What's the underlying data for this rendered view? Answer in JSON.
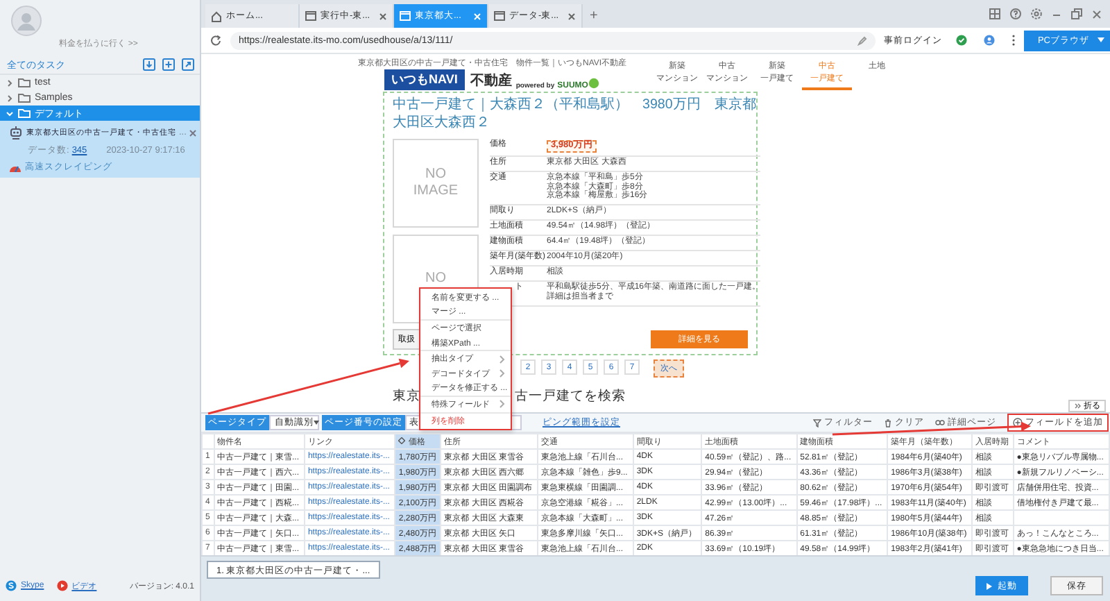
{
  "account": {
    "billing_link": "料金を払うに行く >>"
  },
  "sidebar": {
    "header": "全てのタスク",
    "folders": [
      {
        "label": "test",
        "expanded": false,
        "selected": false
      },
      {
        "label": "Samples",
        "expanded": false,
        "selected": false
      },
      {
        "label": "デフォルト",
        "expanded": true,
        "selected": true,
        "tasks": [
          {
            "title": "東京都大田区の中古一戸建て・中古住宅",
            "more": "...",
            "count_label": "データ数:",
            "count": "345",
            "timestamp": "2023-10-27 9:17:16",
            "mode": "高速スクレイピング"
          }
        ]
      }
    ],
    "help_links": [
      {
        "label": "Skype",
        "kind": "skype"
      },
      {
        "label": "ビデオ",
        "kind": "video"
      }
    ],
    "version": "バージョン: 4.0.1"
  },
  "browser": {
    "tabs": [
      {
        "label": "ホーム...",
        "kind": "home",
        "selected": false,
        "closable": false
      },
      {
        "label": "実行中-東...",
        "kind": "page",
        "selected": false,
        "closable": true
      },
      {
        "label": "東京都大...",
        "kind": "page",
        "selected": true,
        "closable": true
      },
      {
        "label": "データ-東...",
        "kind": "page",
        "selected": false,
        "closable": true
      }
    ],
    "new_tab": "+",
    "url": "https://realestate.its-mo.com/usedhouse/a/13/111/",
    "pre_login": "事前ログイン",
    "browser_mode": "PCブラウザ"
  },
  "page": {
    "breadcrumb": "東京都大田区の中古一戸建て・中古住宅　物件一覧｜いつもNAVI不動産",
    "logo": {
      "brand": "いつもNAVI",
      "category": "不動産",
      "powered_by": "powered by",
      "partner": "SUUMO"
    },
    "nav": [
      {
        "lines": [
          "新築",
          "マンション"
        ],
        "selected": false
      },
      {
        "lines": [
          "中古",
          "マンション"
        ],
        "selected": false
      },
      {
        "lines": [
          "新築",
          "一戸建て"
        ],
        "selected": false
      },
      {
        "lines": [
          "中古",
          "一戸建て"
        ],
        "selected": true
      },
      {
        "lines": [
          "土地"
        ],
        "selected": false
      }
    ],
    "listing": {
      "title_lines": [
        "中古一戸建て｜大森西２（平和島駅）　3980万円　東京都",
        "大田区大森西２"
      ],
      "images": [
        {
          "lines": [
            "NO",
            "IMAGE"
          ]
        },
        {
          "lines": [
            "NO"
          ]
        }
      ],
      "details": [
        {
          "label": "価格",
          "kind": "price",
          "lines": [
            "3,980万円"
          ]
        },
        {
          "label": "住所",
          "kind": "text",
          "lines": [
            "東京都 大田区 大森西"
          ]
        },
        {
          "label": "交通",
          "kind": "text",
          "lines": [
            "京急本線「平和島」歩5分",
            "京急本線「大森町」歩8分",
            "京急本線「梅屋敷」歩16分"
          ]
        },
        {
          "label": "間取り",
          "kind": "text",
          "lines": [
            "2LDK+S（納戸）"
          ]
        },
        {
          "label": "土地面積",
          "kind": "text",
          "lines": [
            "49.54㎡（14.98坪）（登記）"
          ]
        },
        {
          "label": "建物面積",
          "kind": "text",
          "lines": [
            "64.4㎡（19.48坪）（登記）"
          ]
        },
        {
          "label": "築年月(築年数)",
          "kind": "text",
          "lines": [
            "2004年10月(築20年)"
          ]
        },
        {
          "label": "入居時期",
          "kind": "text",
          "lines": [
            "相談"
          ]
        },
        {
          "label": "ト",
          "kind": "text",
          "lines": [
            "平和島駅徒歩5分、平成16年築、南道路に面した一戸建。",
            "詳細は担当者まで"
          ]
        }
      ],
      "contact_button": "取扱",
      "detail_button": "詳細を見る"
    },
    "pagination": {
      "pages": [
        {
          "label": "2",
          "selected": false
        },
        {
          "label": "3",
          "selected": false
        },
        {
          "label": "4",
          "selected": false
        },
        {
          "label": "5",
          "selected": false
        },
        {
          "label": "6",
          "selected": false
        },
        {
          "label": "7",
          "selected": false
        }
      ],
      "next": "次へ"
    },
    "search_heading": [
      "東京",
      "古一戸建てを検索"
    ]
  },
  "context_menu": {
    "groups": [
      [
        {
          "label": "名前を変更する ...",
          "kind": "action"
        },
        {
          "label": "マージ ...",
          "kind": "action"
        }
      ],
      [
        {
          "label": "ページで選択",
          "kind": "action"
        },
        {
          "label": "構築XPath ...",
          "kind": "action"
        }
      ],
      [
        {
          "label": "抽出タイプ",
          "kind": "submenu"
        },
        {
          "label": "デコードタイプ",
          "kind": "submenu"
        },
        {
          "label": "データを修正する ...",
          "kind": "action"
        }
      ],
      [
        {
          "label": "特殊フィールド",
          "kind": "submenu"
        }
      ],
      [
        {
          "label": "列を削除",
          "kind": "danger"
        }
      ]
    ]
  },
  "data_panel": {
    "collapse": "折る",
    "page_type_label": "ページタイプ",
    "page_type_value": "自動識別",
    "page_number_label": "ページ番号の設定",
    "page_number_value": "表",
    "range_link": "ピング範囲を設定",
    "actions": [
      {
        "label": "フィルター",
        "kind": "filter"
      },
      {
        "label": "クリア",
        "kind": "clear"
      },
      {
        "label": "詳細ページ",
        "kind": "link"
      }
    ],
    "add_field": "フィールドを追加",
    "table": {
      "columns": [
        {
          "label": "物件名",
          "kind": "text",
          "selected": false
        },
        {
          "label": "リンク",
          "kind": "link",
          "selected": false
        },
        {
          "label": "価格",
          "kind": "text",
          "selected": true
        },
        {
          "label": "住所",
          "kind": "text",
          "selected": false
        },
        {
          "label": "交通",
          "kind": "text",
          "selected": false
        },
        {
          "label": "間取り",
          "kind": "text",
          "selected": false
        },
        {
          "label": "土地面積",
          "kind": "text",
          "selected": false
        },
        {
          "label": "建物面積",
          "kind": "text",
          "selected": false
        },
        {
          "label": "築年月（築年数）",
          "kind": "text",
          "selected": false
        },
        {
          "label": "入居時期",
          "kind": "text",
          "selected": false
        },
        {
          "label": "コメント",
          "kind": "text",
          "selected": false
        }
      ],
      "rows": [
        {
          "index": "1",
          "cells": [
            "中古一戸建て｜東雪...",
            "https://realestate.its-...",
            "1,780万円",
            "東京都 大田区 東雪谷",
            "東急池上線「石川台...",
            "4DK",
            "40.59㎡（登記）、路...",
            "52.81㎡（登記）",
            "1984年6月(築40年)",
            "相談",
            "●東急リバブル専属物..."
          ]
        },
        {
          "index": "2",
          "cells": [
            "中古一戸建て｜西六...",
            "https://realestate.its-...",
            "1,980万円",
            "東京都 大田区 西六郷",
            "京急本線「雑色」歩9...",
            "3DK",
            "29.94㎡（登記）",
            "43.36㎡（登記）",
            "1986年3月(築38年)",
            "相談",
            "●新規フルリノベーシ..."
          ]
        },
        {
          "index": "3",
          "cells": [
            "中古一戸建て｜田園...",
            "https://realestate.its-...",
            "1,980万円",
            "東京都 大田区 田園調布",
            "東急東横線「田園調...",
            "4DK",
            "33.96㎡（登記）",
            "80.62㎡（登記）",
            "1970年6月(築54年)",
            "即引渡可",
            "店舗併用住宅、投資..."
          ]
        },
        {
          "index": "4",
          "cells": [
            "中古一戸建て｜西糀...",
            "https://realestate.its-...",
            "2,100万円",
            "東京都 大田区 西糀谷",
            "京急空港線「糀谷」...",
            "2LDK",
            "42.99㎡（13.00坪）...",
            "59.46㎡（17.98坪）...",
            "1983年11月(築40年)",
            "相談",
            "借地権付き戸建て最..."
          ]
        },
        {
          "index": "5",
          "cells": [
            "中古一戸建て｜大森...",
            "https://realestate.its-...",
            "2,280万円",
            "東京都 大田区 大森東",
            "京急本線「大森町」...",
            "3DK",
            "47.26㎡",
            "48.85㎡（登記）",
            "1980年5月(築44年)",
            "相談",
            null
          ]
        },
        {
          "index": "6",
          "cells": [
            "中古一戸建て｜矢口...",
            "https://realestate.its-...",
            "2,480万円",
            "東京都 大田区 矢口",
            "東急多摩川線「矢口...",
            "3DK+S（納戸）",
            "86.39㎡",
            "61.31㎡（登記）",
            "1986年10月(築38年)",
            "即引渡可",
            "あっ！こんなところ..."
          ]
        },
        {
          "index": "7",
          "cells": [
            "中古一戸建て｜東雪...",
            "https://realestate.its-...",
            "2,488万円",
            "東京都 大田区 東雪谷",
            "東急池上線「石川台...",
            "2DK",
            "33.69㎡（10.19坪）",
            "49.58㎡（14.99坪）",
            "1983年2月(築41年)",
            "即引渡可",
            "●東急急地につき日当..."
          ]
        }
      ]
    }
  },
  "footer": {
    "task_tabs": [
      {
        "label": "1. 東京都大田区の中古一戸建て・...",
        "selected": true
      }
    ],
    "start": "起動",
    "save": "保存"
  }
}
